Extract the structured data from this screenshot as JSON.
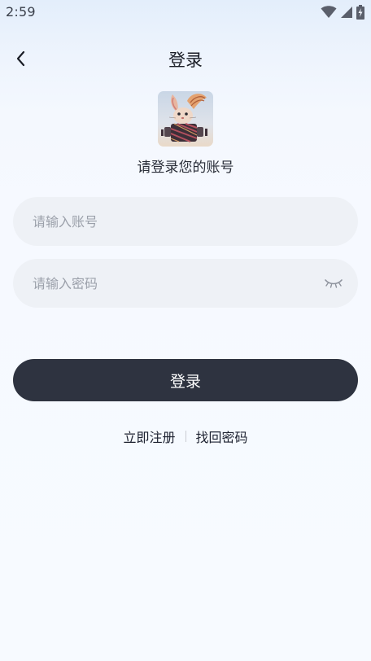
{
  "status_bar": {
    "time": "2:59",
    "icons": [
      "wifi-icon",
      "cellular-signal-icon",
      "battery-charging-icon"
    ]
  },
  "nav": {
    "back_icon": "chevron-left-icon",
    "title": "登录"
  },
  "header": {
    "avatar": "rabbit-robot-avatar",
    "subtitle": "请登录您的账号"
  },
  "form": {
    "account": {
      "value": "",
      "placeholder": "请输入账号"
    },
    "password": {
      "value": "",
      "placeholder": "请输入密码",
      "toggle_icon": "eye-closed-icon"
    },
    "submit_label": "登录"
  },
  "links": {
    "register": "立即注册",
    "recover_password": "找回密码"
  },
  "colors": {
    "button_bg": "#2e3340",
    "field_bg": "#eef1f6",
    "page_bg": "#f7faff"
  }
}
